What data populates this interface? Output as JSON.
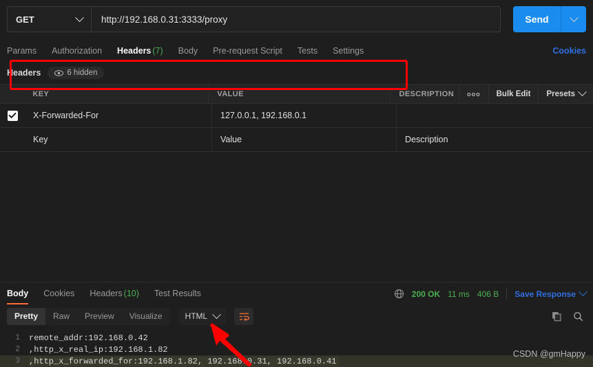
{
  "request": {
    "method": "GET",
    "url": "http://192.168.0.31:3333/proxy",
    "send_label": "Send",
    "tabs": [
      {
        "label": "Params",
        "count": "",
        "active": false
      },
      {
        "label": "Authorization",
        "count": "",
        "active": false
      },
      {
        "label": "Headers",
        "count": "(7)",
        "active": true
      },
      {
        "label": "Body",
        "count": "",
        "active": false
      },
      {
        "label": "Pre-request Script",
        "count": "",
        "active": false
      },
      {
        "label": "Tests",
        "count": "",
        "active": false
      },
      {
        "label": "Settings",
        "count": "",
        "active": false
      }
    ],
    "cookies_link": "Cookies"
  },
  "headers_panel": {
    "title": "Headers",
    "hidden_pill": "6 hidden",
    "columns": {
      "key": "KEY",
      "value": "VALUE",
      "description": "DESCRIPTION"
    },
    "actions": {
      "more": "ooo",
      "bulk_edit": "Bulk Edit",
      "presets": "Presets"
    },
    "rows": [
      {
        "checked": true,
        "key": "X-Forwarded-For",
        "value": "127.0.0.1,  192.168.0.1",
        "description": ""
      }
    ],
    "placeholders": {
      "key": "Key",
      "value": "Value",
      "description": "Description"
    }
  },
  "response": {
    "tabs": [
      {
        "label": "Body",
        "count": "",
        "active": true
      },
      {
        "label": "Cookies",
        "count": "",
        "active": false
      },
      {
        "label": "Headers",
        "count": "(10)",
        "active": false
      },
      {
        "label": "Test Results",
        "count": "",
        "active": false
      }
    ],
    "status": "200 OK",
    "time": "11 ms",
    "size": "406 B",
    "save_response": "Save Response",
    "view_modes": [
      {
        "label": "Pretty",
        "selected": true
      },
      {
        "label": "Raw",
        "selected": false
      },
      {
        "label": "Preview",
        "selected": false
      },
      {
        "label": "Visualize",
        "selected": false
      }
    ],
    "format": "HTML",
    "body_lines": [
      {
        "n": "1",
        "text": "remote_addr:192.168.0.42",
        "highlight": false
      },
      {
        "n": "2",
        "text": ",http_x_real_ip:192.168.1.82",
        "highlight": false
      },
      {
        "n": "3",
        "text": ",http_x_forwarded_for:192.168.1.82, 192.168.0.31, 192.168.0.41",
        "highlight": true
      }
    ]
  },
  "annotations": {
    "watermark": "CSDN @gmHappy",
    "highlight_color": "#ff0000",
    "accent_color": "#ff6c37",
    "send_color": "#1a8cf0",
    "success_color": "#4caf50",
    "link_color": "#2f6fe0"
  }
}
